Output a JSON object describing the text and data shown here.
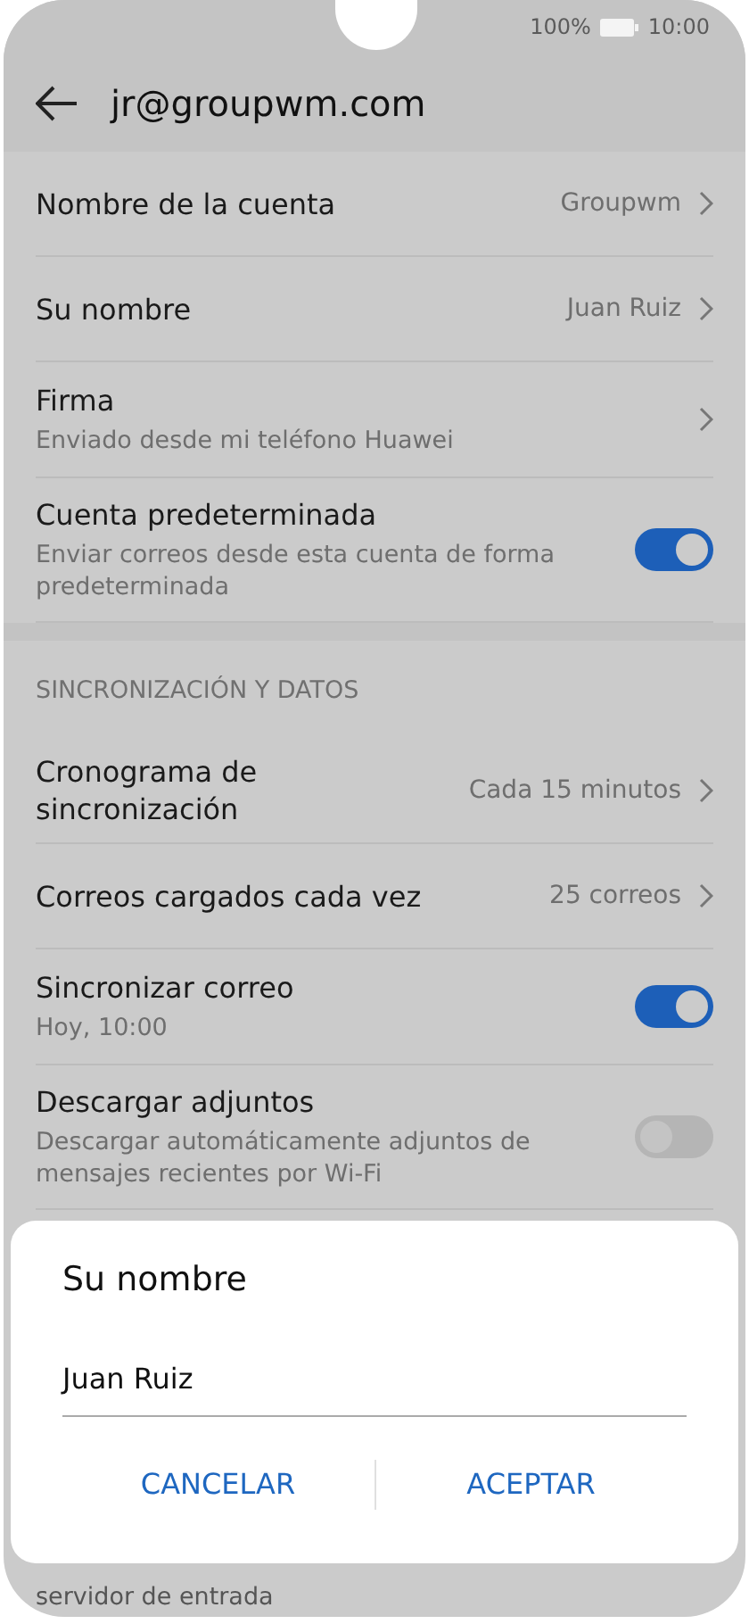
{
  "status_bar": {
    "battery": "100%",
    "time": "10:00"
  },
  "header": {
    "title": "jr@groupwm.com"
  },
  "sections": [
    {
      "items": [
        {
          "kind": "value",
          "title": "Nombre de la cuenta",
          "value": "Groupwm"
        },
        {
          "kind": "value",
          "title": "Su nombre",
          "value": "Juan Ruiz"
        },
        {
          "kind": "link",
          "title": "Firma",
          "subtitle": "Enviado desde mi teléfono Huawei"
        },
        {
          "kind": "toggle",
          "title": "Cuenta predeterminada",
          "subtitle": "Enviar correos desde esta cuenta de forma predeterminada",
          "on": true
        }
      ]
    },
    {
      "header": "SINCRONIZACIÓN Y DATOS",
      "items": [
        {
          "kind": "value",
          "title": "Cronograma de sincronización",
          "value": "Cada 15 minutos"
        },
        {
          "kind": "value",
          "title": "Correos cargados cada vez",
          "value": "25 correos"
        },
        {
          "kind": "toggle",
          "title": "Sincronizar correo",
          "subtitle": "Hoy, 10:00",
          "on": true
        },
        {
          "kind": "toggle",
          "title": "Descargar adjuntos",
          "subtitle": "Descargar automáticamente adjuntos de mensajes recientes por Wi-Fi",
          "on": false
        }
      ]
    }
  ],
  "partial_text": "servidor de entrada",
  "dialog": {
    "title": "Su nombre",
    "value": "Juan Ruiz",
    "buttons": [
      "CANCELAR",
      "ACEPTAR"
    ]
  }
}
